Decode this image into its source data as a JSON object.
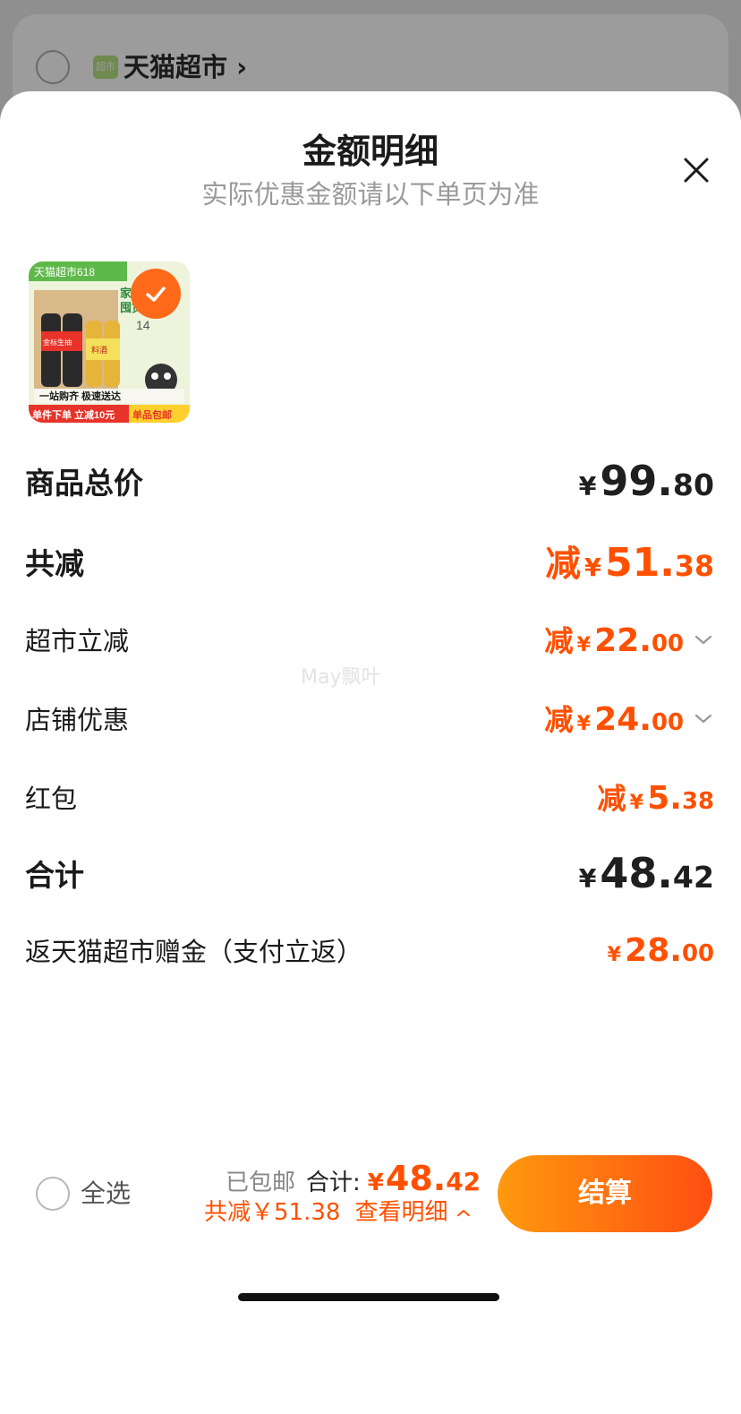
{
  "background": {
    "store_icon_text": "超市",
    "store_name": "天猫超市",
    "store_chevron": "›"
  },
  "sheet": {
    "title": "金额明细",
    "subtitle": "实际优惠金额请以下单页为准"
  },
  "product": {
    "thumb_texts": {
      "banner": "天猫超市618",
      "side_heading": "家庭\n囤货",
      "count": "14",
      "tagline": "一站购齐 极速送达",
      "promo_left": "单件下单 立减10元",
      "promo_right": "单品包邮",
      "label_left": "金标生抽",
      "label_right": "料酒"
    }
  },
  "breakdown": {
    "total_price": {
      "label": "商品总价",
      "currency": "¥",
      "int": "99.",
      "dec": "80"
    },
    "total_discount": {
      "label": "共减",
      "prefix": "减",
      "currency": "¥",
      "int": "51.",
      "dec": "38"
    },
    "supermarket_discount": {
      "label": "超市立减",
      "prefix": "减",
      "currency": "¥",
      "int": "22.",
      "dec": "00"
    },
    "store_discount": {
      "label": "店铺优惠",
      "prefix": "减",
      "currency": "¥",
      "int": "24.",
      "dec": "00"
    },
    "red_packet": {
      "label": "红包",
      "prefix": "减",
      "currency": "¥",
      "int": "5.",
      "dec": "38"
    },
    "subtotal": {
      "label": "合计",
      "currency": "¥",
      "int": "48.",
      "dec": "42"
    },
    "cashback": {
      "label": "返天猫超市赠金（支付立返）",
      "currency": "¥",
      "int": "28.",
      "dec": "00"
    }
  },
  "watermark": "May飘叶",
  "footer": {
    "select_all": "全选",
    "shipped": "已包邮",
    "total_label": "合计:",
    "total_currency": "¥",
    "total_int": "48.",
    "total_dec": "42",
    "discount_text": "共减￥51.38",
    "detail_link": "查看明细",
    "checkout": "结算"
  },
  "colors": {
    "accent": "#ff5000",
    "button_gradient_start": "#ff9a0e",
    "button_gradient_end": "#ff4e12"
  }
}
